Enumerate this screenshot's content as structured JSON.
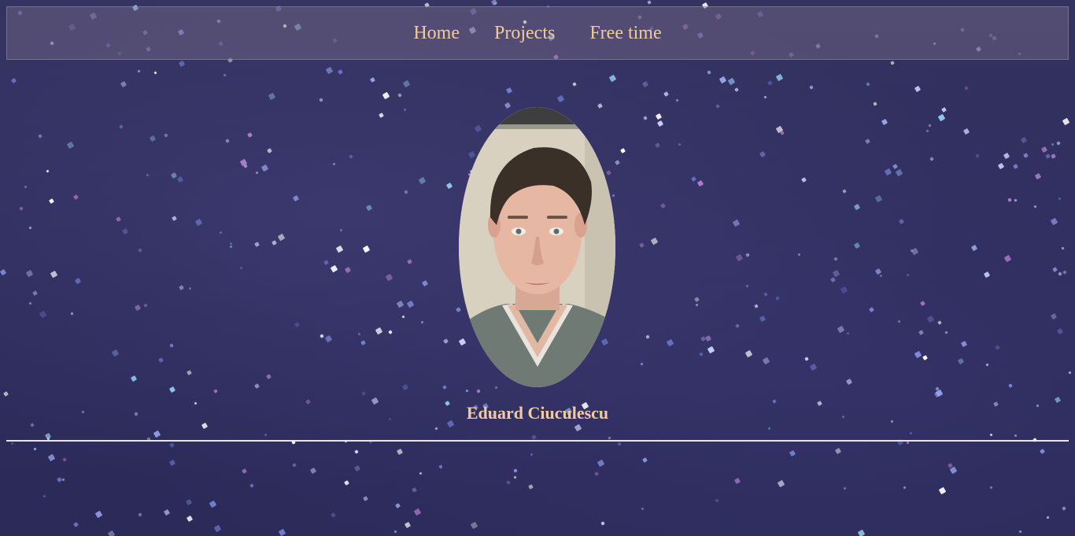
{
  "nav": {
    "items": [
      {
        "label": "Home"
      },
      {
        "label": "Projects"
      },
      {
        "label": "Free time"
      }
    ]
  },
  "profile": {
    "name": "Eduard Ciuculescu"
  },
  "colors": {
    "accent_text": "#f3c9a0",
    "background": "#2f2d5c",
    "divider": "#e9e6f0"
  }
}
